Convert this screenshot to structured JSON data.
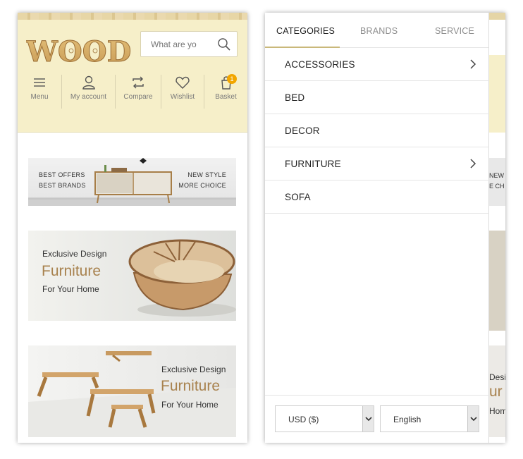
{
  "shop": {
    "logo_text": "WOOD",
    "search": {
      "placeholder": "What are yo"
    },
    "nav": [
      {
        "label": "Menu",
        "icon": "hamburger-menu-icon"
      },
      {
        "label": "My account",
        "icon": "user-icon"
      },
      {
        "label": "Compare",
        "icon": "compare-arrows-icon"
      },
      {
        "label": "Wishlist",
        "icon": "heart-icon"
      },
      {
        "label": "Basket",
        "icon": "basket-icon",
        "badge": "1"
      }
    ],
    "banners": [
      {
        "left_lines": [
          "BEST OFFERS",
          "BEST BRANDS"
        ],
        "right_lines": [
          "NEW STYLE",
          "MORE CHOICE"
        ]
      },
      {
        "small_top": "Exclusive Design",
        "big": "Furniture",
        "small_bottom": "For Your Home"
      },
      {
        "small_top": "Exclusive Design",
        "big": "Furniture",
        "small_bottom": "For Your Home"
      }
    ]
  },
  "drawer": {
    "tabs": [
      {
        "label": "CATEGORIES",
        "active": true
      },
      {
        "label": "BRANDS",
        "active": false
      },
      {
        "label": "SERVICE",
        "active": false
      }
    ],
    "categories": [
      {
        "label": "ACCESSORIES",
        "has_children": true
      },
      {
        "label": "BED",
        "has_children": false
      },
      {
        "label": "DECOR",
        "has_children": false
      },
      {
        "label": "FURNITURE",
        "has_children": true
      },
      {
        "label": "SOFA",
        "has_children": false
      }
    ],
    "currency": {
      "value": "USD ($)"
    },
    "language": {
      "value": "English"
    }
  },
  "background_page": {
    "banner1_fragment": [
      "NEW",
      "E CH"
    ],
    "banner3_fragment": [
      "Desi",
      "ur",
      "Hom"
    ]
  },
  "colors": {
    "header_bg": "#f6efc9",
    "accent_gold": "#a8824e",
    "badge_orange": "#f2a600",
    "tab_underline": "#c9b87a"
  }
}
